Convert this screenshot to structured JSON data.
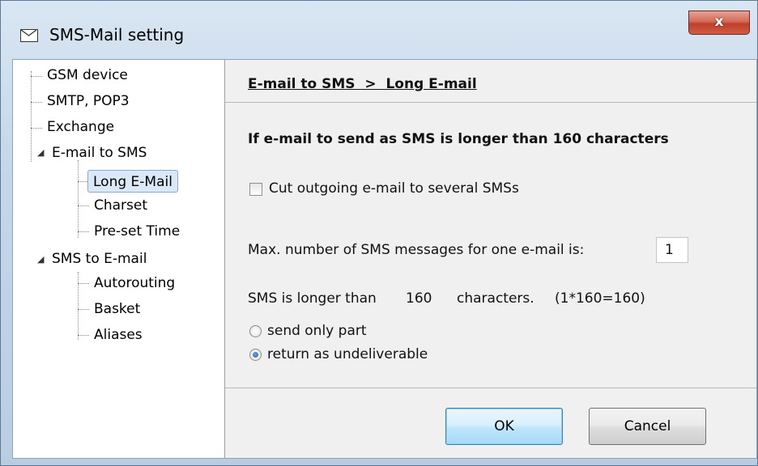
{
  "window": {
    "title": "SMS-Mail setting",
    "close_label": "x"
  },
  "tree": {
    "items": [
      {
        "label": "GSM device"
      },
      {
        "label": "SMTP, POP3"
      },
      {
        "label": "Exchange"
      },
      {
        "label": "E-mail to SMS",
        "expanded": true
      },
      {
        "label": "Long E-Mail",
        "selected": true
      },
      {
        "label": "Charset"
      },
      {
        "label": "Pre-set Time"
      },
      {
        "label": "SMS to E-mail",
        "expanded": true
      },
      {
        "label": "Autorouting"
      },
      {
        "label": "Basket"
      },
      {
        "label": "Aliases"
      }
    ]
  },
  "panel": {
    "breadcrumb": "E-mail to SMS  >  Long E-mail",
    "heading": "If e-mail to send as SMS is longer than 160 characters",
    "cut_checkbox": {
      "label": "Cut outgoing e-mail to several SMSs",
      "checked": false
    },
    "max_label": "Max. number of SMS messages for one e-mail is:",
    "max_value": "1",
    "longer_prefix": "SMS is longer than",
    "longer_value": "160",
    "longer_suffix": "characters.",
    "longer_formula": "(1*160=160)",
    "radio_send_part": {
      "label": "send only part",
      "checked": false
    },
    "radio_return": {
      "label": "return as undeliverable",
      "checked": true
    }
  },
  "buttons": {
    "ok": "OK",
    "cancel": "Cancel"
  }
}
